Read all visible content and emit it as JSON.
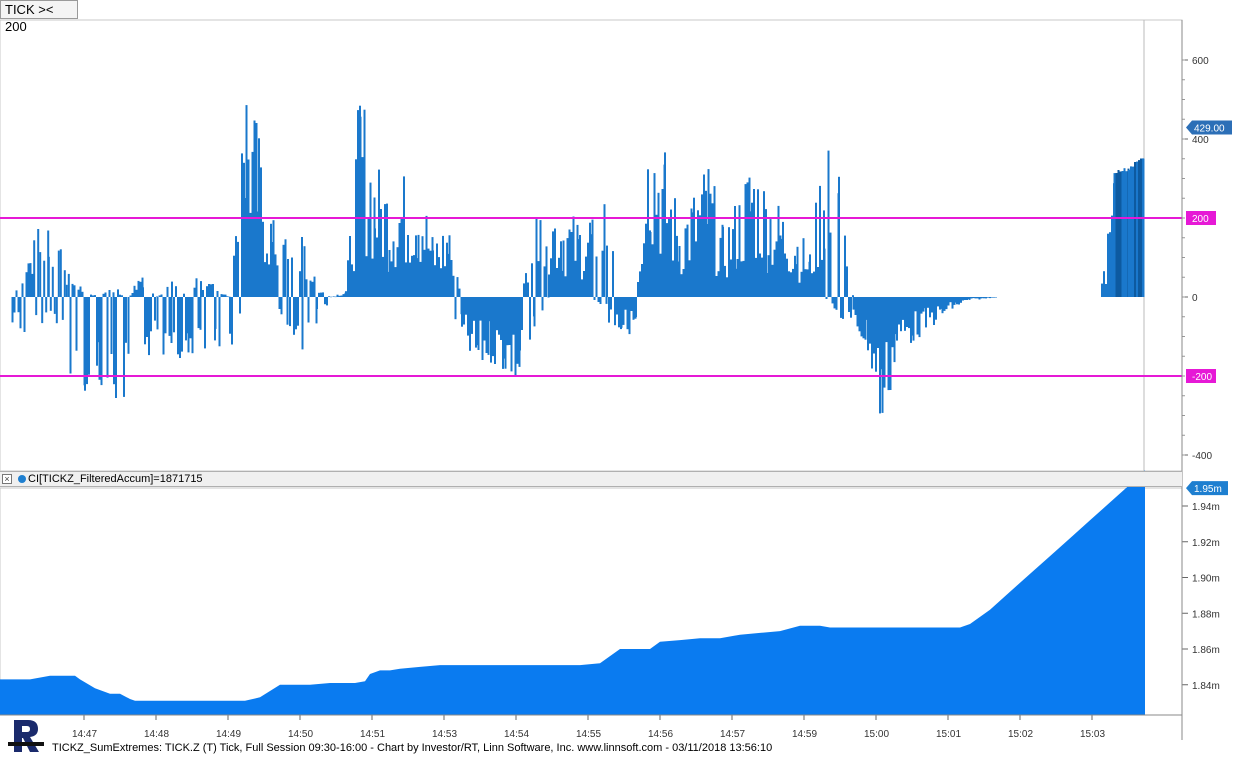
{
  "title_button": "TICK >< 200",
  "indicator_label": "CI[TICKZ_FilteredAccum]=1871715",
  "footer_text": "TICKZ_SumExtremes: TICK.Z (T) Tick, Full Session 09:30-16:00 - Chart by Investor/RT, Linn Software, Inc. www.linnsoft.com - 03/11/2018 13:56:10",
  "colors": {
    "bar": "#1a78cc",
    "bar_dark": "#0d5aa0",
    "area": "#0a7bf0",
    "threshold": "#e619d6",
    "label_box": "#2c6fb7"
  },
  "icons": [
    "close-icon",
    "series-dot-icon",
    "logo-icon"
  ],
  "chart_data": [
    {
      "type": "bar",
      "title": "TICK >< 200",
      "ylim": [
        -410,
        650
      ],
      "y_ticks": [
        "600",
        "400",
        "0",
        "-400"
      ],
      "x_ticks": [
        "14:47",
        "14:48",
        "14:49",
        "14:50",
        "14:51",
        "14:53",
        "14:54",
        "14:55",
        "14:56",
        "14:57",
        "14:59",
        "15:00",
        "15:01",
        "15:02",
        "15:03"
      ],
      "thresholds": [
        {
          "value": 200,
          "label": "200"
        },
        {
          "value": -200,
          "label": "-200"
        }
      ],
      "last_value_label": "429.00",
      "last_value": 429,
      "series_envelope": {
        "x": [
          "14:46.0",
          "14:46.3",
          "14:46.5",
          "14:46.8",
          "14:47.0",
          "14:47.2",
          "14:47.4",
          "14:47.6",
          "14:47.8",
          "14:48.0",
          "14:48.2",
          "14:48.4",
          "14:48.6",
          "14:48.8",
          "14:49.0",
          "14:49.2",
          "14:49.4",
          "14:49.6",
          "14:49.8",
          "14:50.0",
          "14:50.2",
          "14:50.4",
          "14:50.6",
          "14:50.8",
          "14:51.0",
          "14:51.2",
          "14:51.4",
          "14:51.6",
          "14:51.8",
          "14:52.0",
          "14:52.2",
          "14:52.4",
          "14:52.6",
          "14:52.8",
          "14:53.0",
          "14:53.2",
          "14:53.4",
          "14:53.6",
          "14:53.8",
          "14:54.0",
          "14:54.2",
          "14:54.4",
          "14:54.6",
          "14:54.8",
          "14:55.0",
          "14:55.2",
          "14:55.4",
          "14:55.6",
          "14:55.8",
          "14:56.0",
          "14:56.2",
          "14:56.4",
          "14:56.6",
          "14:56.8",
          "14:57.0",
          "14:57.2",
          "14:57.4",
          "14:57.6",
          "14:57.8",
          "14:58.0",
          "14:58.2",
          "14:58.4",
          "14:58.6",
          "14:58.8",
          "14:59.0",
          "14:59.2",
          "14:59.4",
          "14:59.6",
          "14:59.8",
          "15:00.0",
          "15:00.2",
          "15:00.4",
          "15:00.6",
          "15:00.8",
          "15:01.0",
          "15:01.2",
          "15:01.4",
          "15:01.6",
          "15:01.8",
          "15:02.0",
          "15:02.2",
          "15:02.4",
          "15:02.6",
          "15:02.8",
          "15:03.0",
          "15:03.2",
          "15:03.4",
          "15:03.6",
          "15:03.8"
        ],
        "max": [
          0,
          150,
          250,
          60,
          20,
          0,
          30,
          0,
          80,
          0,
          40,
          20,
          60,
          30,
          0,
          650,
          420,
          200,
          180,
          160,
          30,
          0,
          20,
          570,
          350,
          300,
          320,
          340,
          160,
          200,
          0,
          0,
          0,
          0,
          0,
          220,
          260,
          240,
          200,
          240,
          250,
          0,
          0,
          500,
          380,
          220,
          280,
          360,
          180,
          260,
          380,
          300,
          240,
          200,
          120,
          420,
          320,
          0,
          0,
          0,
          0,
          0,
          0,
          0,
          0,
          0,
          0,
          0,
          0,
          0,
          0,
          0,
          0,
          0,
          0,
          320,
          330,
          360,
          380,
          400,
          400,
          410,
          415,
          420,
          425,
          429,
          429,
          429,
          429
        ],
        "min": [
          -100,
          -130,
          -50,
          -200,
          -250,
          -380,
          -280,
          -290,
          -200,
          -160,
          -150,
          -160,
          -200,
          -190,
          -150,
          0,
          0,
          0,
          -100,
          -140,
          -90,
          0,
          0,
          0,
          0,
          0,
          0,
          0,
          0,
          0,
          -130,
          -200,
          -170,
          -200,
          -250,
          -100,
          0,
          0,
          0,
          0,
          -60,
          -100,
          -90,
          0,
          0,
          0,
          0,
          0,
          0,
          0,
          0,
          0,
          0,
          0,
          0,
          0,
          -50,
          -80,
          -150,
          -370,
          -150,
          -120,
          -90,
          -60,
          -30,
          -10,
          -5,
          0,
          0,
          0,
          0,
          0,
          0,
          0,
          0,
          0,
          0,
          0,
          0,
          0,
          0,
          0,
          0,
          0,
          0,
          0,
          0,
          0,
          0
        ]
      }
    },
    {
      "type": "area",
      "title": "CI[TICKZ_FilteredAccum]",
      "value_label": "1871715",
      "ylim": [
        1.8225,
        1.9625
      ],
      "y_ticks": [
        "1.94m",
        "1.92m",
        "1.90m",
        "1.88m",
        "1.86m",
        "1.84m"
      ],
      "last_value_label": "1.95m",
      "last_value": 1.95,
      "x": [
        0,
        30,
        50,
        75,
        80,
        95,
        110,
        120,
        130,
        135,
        145,
        170,
        200,
        220,
        230,
        245,
        260,
        280,
        290,
        310,
        330,
        345,
        355,
        365,
        370,
        380,
        390,
        400,
        420,
        440,
        450,
        460,
        480,
        500,
        520,
        540,
        560,
        580,
        600,
        610,
        620,
        630,
        650,
        660,
        680,
        700,
        720,
        740,
        760,
        780,
        800,
        810,
        820,
        830,
        840,
        860,
        880,
        900,
        920,
        940,
        960,
        970,
        990,
        1010,
        1030,
        1050,
        1070,
        1090,
        1110,
        1130,
        1145
      ],
      "y": [
        1.843,
        1.843,
        1.845,
        1.845,
        1.843,
        1.838,
        1.835,
        1.835,
        1.832,
        1.831,
        1.831,
        1.831,
        1.831,
        1.831,
        1.831,
        1.831,
        1.833,
        1.84,
        1.84,
        1.84,
        1.841,
        1.841,
        1.841,
        1.842,
        1.846,
        1.848,
        1.848,
        1.849,
        1.85,
        1.851,
        1.851,
        1.851,
        1.851,
        1.851,
        1.851,
        1.851,
        1.851,
        1.851,
        1.852,
        1.856,
        1.86,
        1.86,
        1.86,
        1.864,
        1.865,
        1.866,
        1.866,
        1.868,
        1.869,
        1.87,
        1.873,
        1.873,
        1.873,
        1.872,
        1.872,
        1.872,
        1.872,
        1.872,
        1.872,
        1.872,
        1.872,
        1.874,
        1.882,
        1.892,
        1.902,
        1.912,
        1.922,
        1.932,
        1.942,
        1.952,
        1.96
      ]
    }
  ]
}
